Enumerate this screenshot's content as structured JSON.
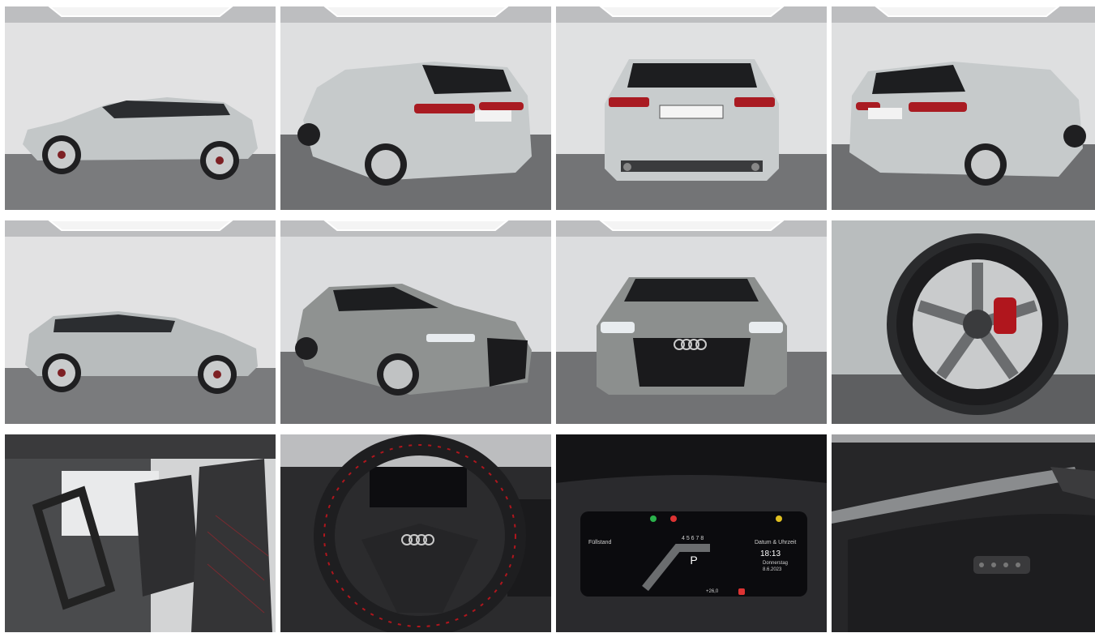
{
  "gallery": {
    "thumbnails": [
      {
        "view": "side-left",
        "body_color": "#c3c7c8"
      },
      {
        "view": "rear-three-quarter-left",
        "body_color": "#c6cacb"
      },
      {
        "view": "rear",
        "body_color": "#c8cccd"
      },
      {
        "view": "rear-three-quarter-right",
        "body_color": "#c6cacb"
      },
      {
        "view": "side-right",
        "body_color": "#b8bcbd"
      },
      {
        "view": "front-three-quarter-left",
        "body_color": "#8f9291"
      },
      {
        "view": "front",
        "body_color": "#8c8f8e"
      },
      {
        "view": "wheel-detail",
        "body_color": "#b9bdbe"
      },
      {
        "view": "interior-seats",
        "body_color": "#3a3a3c"
      },
      {
        "view": "steering-wheel",
        "body_color": "#2b2b2d"
      },
      {
        "view": "digital-cockpit",
        "body_color": "#1a1a1d"
      },
      {
        "view": "door-panel",
        "body_color": "#262628"
      }
    ],
    "cockpit": {
      "gear": "P",
      "time": "18:13",
      "day": "Donnerstag",
      "date": "8.6.2023",
      "label_left": "Füllstand",
      "label_right": "Datum & Uhrzeit",
      "temp": "+26,0",
      "gear_scale": "4 5 6 7 8"
    }
  }
}
